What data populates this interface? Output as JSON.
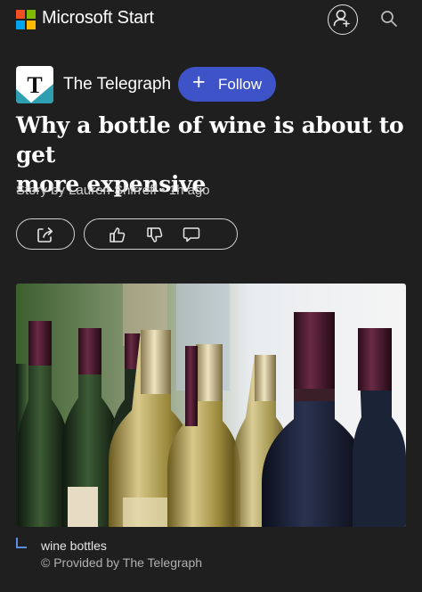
{
  "app": {
    "brand": "Microsoft Start",
    "logo_colors": [
      "#f25022",
      "#7fba00",
      "#00a4ef",
      "#ffb900"
    ],
    "profile_icon": "add-person-icon",
    "search_icon": "search-icon"
  },
  "source": {
    "logo_letter": "T",
    "name": "The Telegraph",
    "follow_label": "Follow",
    "follow_color": "#3e53c8"
  },
  "article": {
    "headline_line1": "Why a bottle of wine is about to get",
    "headline_line2": "more expensive",
    "byline": "Story by Lauren Shirreff • 1h ago"
  },
  "actions": {
    "share_icon": "share-icon",
    "like_icon": "thumbs-up-icon",
    "dislike_icon": "thumbs-down-icon",
    "comment_icon": "comment-icon"
  },
  "image": {
    "caption": "wine bottles",
    "credit": "© Provided by The Telegraph",
    "accent": "#5a8ee6"
  }
}
